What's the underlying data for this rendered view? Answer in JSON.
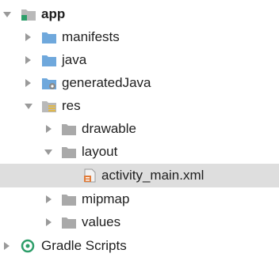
{
  "tree": {
    "app": {
      "label": "app",
      "expanded": true,
      "icon": "module-folder-icon"
    },
    "manifests": {
      "label": "manifests",
      "icon": "folder-blue-icon"
    },
    "java": {
      "label": "java",
      "icon": "folder-blue-icon"
    },
    "generated_java": {
      "label": "generatedJava",
      "icon": "folder-generated-icon"
    },
    "res": {
      "label": "res",
      "expanded": true,
      "icon": "resources-folder-icon"
    },
    "drawable": {
      "label": "drawable",
      "icon": "folder-gray-icon"
    },
    "layout": {
      "label": "layout",
      "expanded": true,
      "icon": "folder-gray-icon"
    },
    "activity_main": {
      "label": "activity_main.xml",
      "selected": true,
      "icon": "layout-file-icon"
    },
    "mipmap": {
      "label": "mipmap",
      "icon": "folder-gray-icon"
    },
    "values": {
      "label": "values",
      "icon": "folder-gray-icon"
    },
    "gradle_scripts": {
      "label": "Gradle Scripts",
      "icon": "gradle-icon"
    }
  },
  "colors": {
    "selection_bg": "#dedede",
    "folder_blue": "#6fa8dc",
    "folder_gray": "#a9a9a9",
    "layout_file_orange": "#e07b39",
    "gradle_green": "#2e9e6a"
  }
}
